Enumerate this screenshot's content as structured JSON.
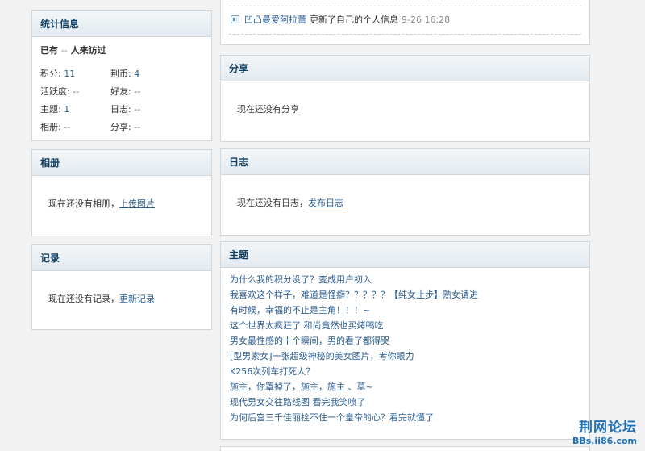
{
  "stats": {
    "title": "统计信息",
    "visitors_prefix": "已有",
    "visitors_count": "--",
    "visitors_suffix": "人来访过",
    "rows": [
      [
        {
          "label": "积分:",
          "value": "11"
        },
        {
          "label": "荆币:",
          "value": "4"
        }
      ],
      [
        {
          "label": "活跃度:",
          "value": "--"
        },
        {
          "label": "好友:",
          "value": "--"
        }
      ],
      [
        {
          "label": "主题:",
          "value": "1"
        },
        {
          "label": "日志:",
          "value": "--"
        }
      ],
      [
        {
          "label": "相册:",
          "value": "--"
        },
        {
          "label": "分享:",
          "value": "--"
        }
      ]
    ]
  },
  "album": {
    "title": "相册",
    "empty_text": "现在还没有相册，",
    "action": "上传图片"
  },
  "log": {
    "title": "记录",
    "empty_text": "现在还没有记录，",
    "action": "更新记录"
  },
  "feed": {
    "user": "凹凸曼爱阿拉蕾",
    "action": "更新了自己的个人信息",
    "time": "9-26 16:28"
  },
  "share": {
    "title": "分享",
    "empty_text": "现在还没有分享"
  },
  "diary": {
    "title": "日志",
    "empty_text": "现在还没有日志，",
    "action": "发布日志"
  },
  "topics": {
    "title": "主题",
    "items": [
      "为什么我的积分没了？变成用户初入",
      "我喜欢这个样子，难道是怪癖？？？？？【纯女止步】熟女请进",
      "有时候，幸福的不止是主角！！！~",
      "这个世界太疯狂了 和尚竟然也买烤鸭吃",
      "男女最性感的十个瞬间，男的看了都得哭",
      "[型男索女]一张超级神秘的美女图片，考你眼力",
      "K256次列车打死人？",
      "施主，你罩掉了，施主，施主 、草~",
      "现代男女交往路线图 看完我笑喷了",
      "为何后宫三千佳丽拴不住一个皇帝的心？看完就懂了"
    ]
  },
  "watermark": {
    "title": "荆网论坛",
    "url": "BBs.ii86.com"
  }
}
